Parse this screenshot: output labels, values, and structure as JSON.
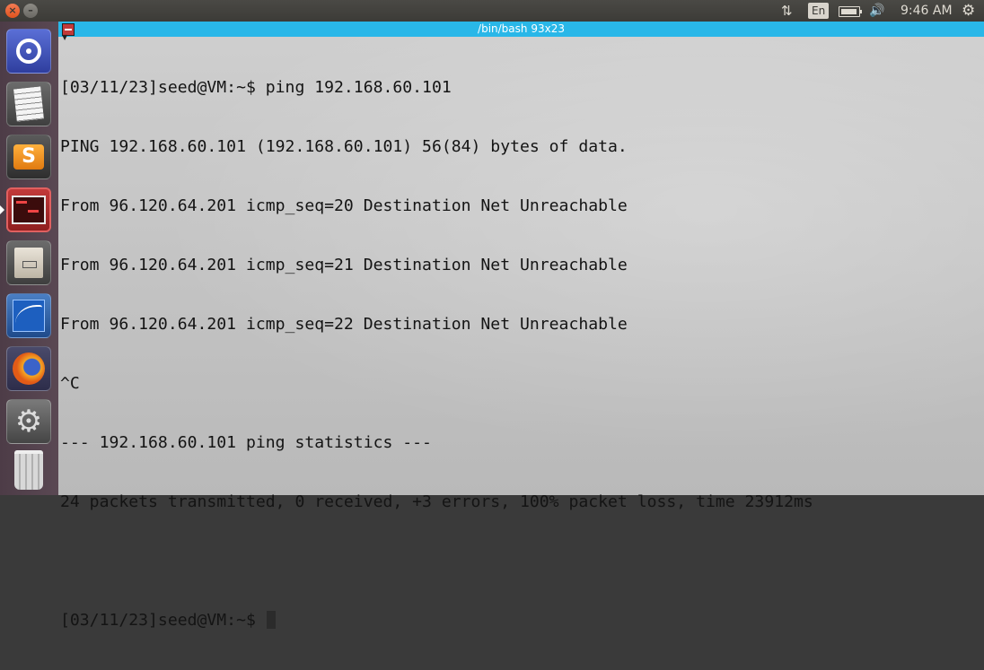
{
  "topbar": {
    "close_icon": "×",
    "minimize_icon": "–",
    "network_icon": "⇅",
    "language": "En",
    "battery": "battery-icon",
    "volume_icon": "🔊",
    "clock": "9:46 AM",
    "settings_icon": "⚙"
  },
  "launcher": {
    "items": [
      {
        "name": "ubuntu-dash-icon"
      },
      {
        "name": "text-editor-icon"
      },
      {
        "name": "sublime-text-icon",
        "glyph": "S"
      },
      {
        "name": "terminal-icon"
      },
      {
        "name": "file-manager-icon"
      },
      {
        "name": "wireshark-icon"
      },
      {
        "name": "firefox-icon"
      },
      {
        "name": "system-settings-icon",
        "glyph": "⚙"
      },
      {
        "name": "trash-icon"
      }
    ]
  },
  "terminal": {
    "title": "/bin/bash 93x23",
    "lines": [
      "[03/11/23]seed@VM:~$ ping 192.168.60.101",
      "PING 192.168.60.101 (192.168.60.101) 56(84) bytes of data.",
      "From 96.120.64.201 icmp_seq=20 Destination Net Unreachable",
      "From 96.120.64.201 icmp_seq=21 Destination Net Unreachable",
      "From 96.120.64.201 icmp_seq=22 Destination Net Unreachable",
      "^C",
      "--- 192.168.60.101 ping statistics ---",
      "24 packets transmitted, 0 received, +3 errors, 100% packet loss, time 23912ms",
      ""
    ],
    "prompt": "[03/11/23]seed@VM:~$ "
  },
  "colors": {
    "title_bar": "#29b7e8",
    "launcher_bg": "#5a4853",
    "topbar_bg": "#3c3b37"
  }
}
